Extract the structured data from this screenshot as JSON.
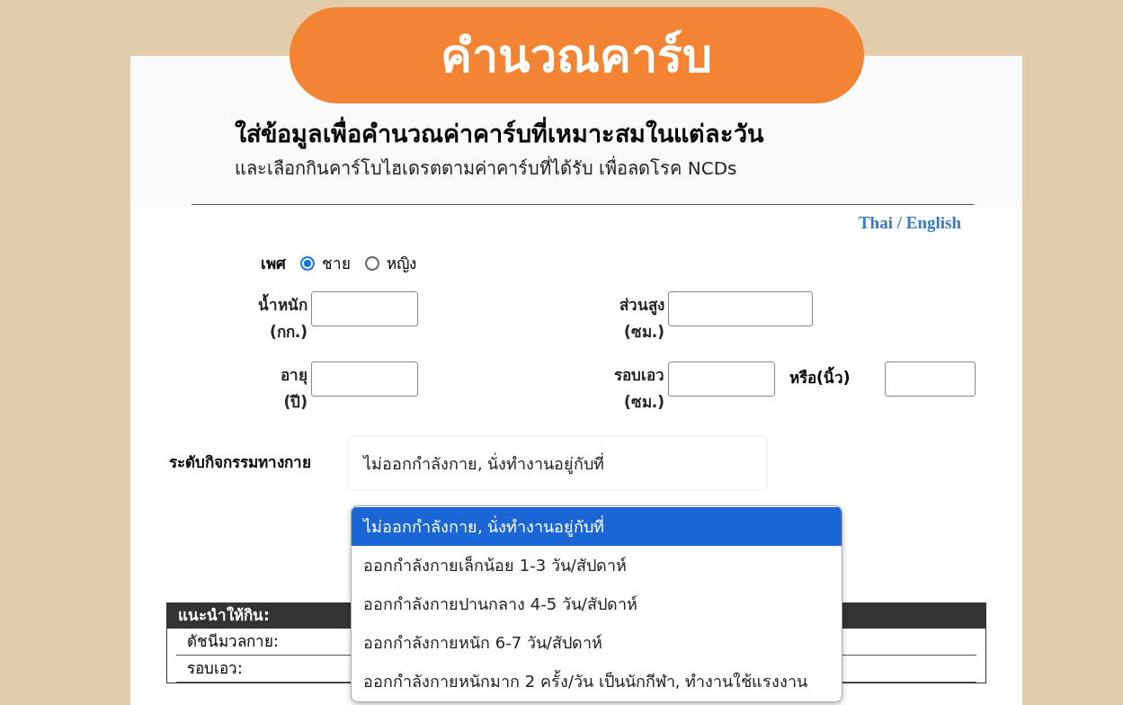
{
  "banner": {
    "title": "คำนวณคาร์บ",
    "headline": "ใส่ข้อมูลเพื่อคำนวณค่าคาร์บที่เหมาะสมในแต่ละวัน",
    "subline": "และเลือกกินคาร์โบไฮเดรตตามค่าคาร์บที่ได้รับ เพื่อลดโรค NCDs"
  },
  "language_link": "Thai / English",
  "sex": {
    "label": "เพศ",
    "options": [
      {
        "label": "ชาย",
        "selected": true
      },
      {
        "label": "หญิง",
        "selected": false
      }
    ]
  },
  "fields": [
    {
      "label": "น้ำหนัก",
      "unit": "(กก.)"
    },
    {
      "label": "ส่วนสูง",
      "unit": "(ซม.)"
    },
    {
      "label": "อายุ",
      "unit": "(ปี)"
    },
    {
      "label": "รอบเอว",
      "unit": "(ซม.)",
      "alt_label": "หรือ(นิ้ว)"
    }
  ],
  "activity": {
    "label": "ระดับกิจกรรมทางกาย",
    "value": "ไม่ออกกำลังกาย, นั่งทำงานอยู่กับที่",
    "options": [
      {
        "label": "ไม่ออกกำลังกาย, นั่งทำงานอยู่กับที่",
        "selected": true
      },
      {
        "label": "ออกกำลังกายเล็กน้อย 1-3 วัน/สัปดาห์",
        "selected": false
      },
      {
        "label": "ออกกำลังกายปานกลาง 4-5 วัน/สัปดาห์",
        "selected": false
      },
      {
        "label": "ออกกำลังกายหนัก 6-7 วัน/สัปดาห์",
        "selected": false
      },
      {
        "label": "ออกกำลังกายหนักมาก 2 ครั้ง/วัน เป็นนักกีฬา, ทำงานใช้แรงงาน",
        "selected": false
      }
    ]
  },
  "results": {
    "title": "แนะนำให้กิน:",
    "rows": [
      "ดัชนีมวลกาย:",
      "รอบเอว:"
    ]
  }
}
